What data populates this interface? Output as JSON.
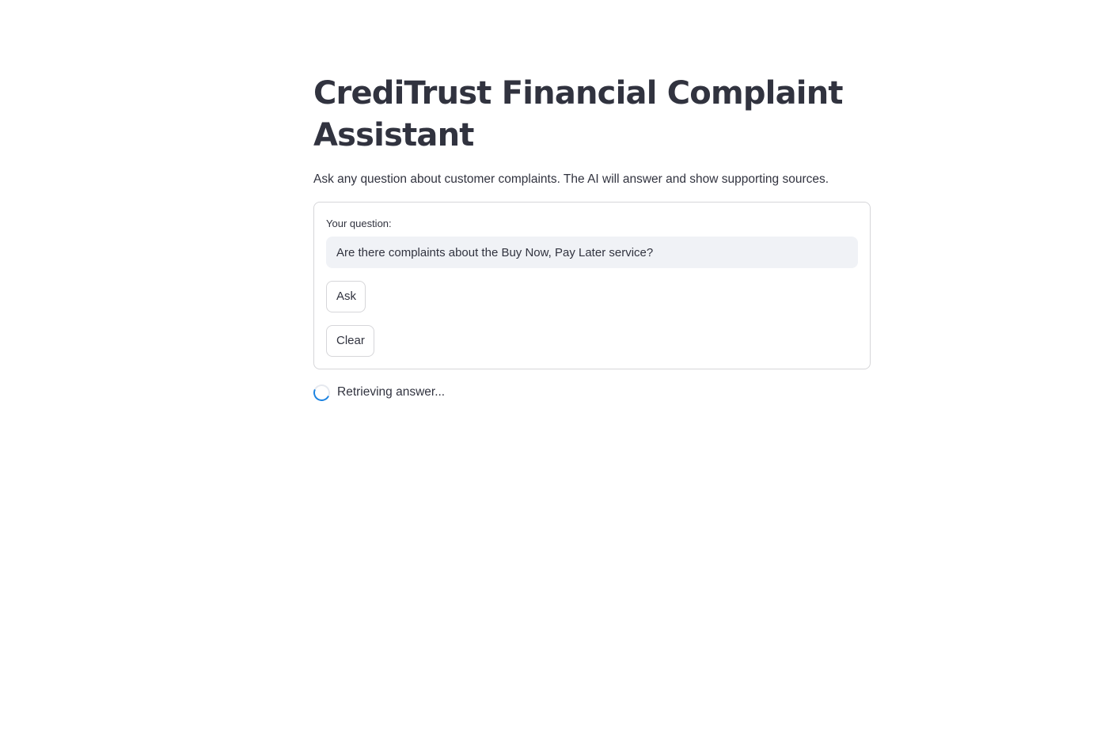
{
  "header": {
    "title": "CrediTrust Financial Complaint Assistant",
    "subtitle": "Ask any question about customer complaints. The AI will answer and show supporting sources."
  },
  "form": {
    "question_label": "Your question:",
    "question_value": "Are there complaints about the Buy Now, Pay Later service?",
    "ask_label": "Ask",
    "clear_label": "Clear"
  },
  "status": {
    "icon": "spinner-icon",
    "text": "Retrieving answer...",
    "accent": "#1c83e1"
  }
}
